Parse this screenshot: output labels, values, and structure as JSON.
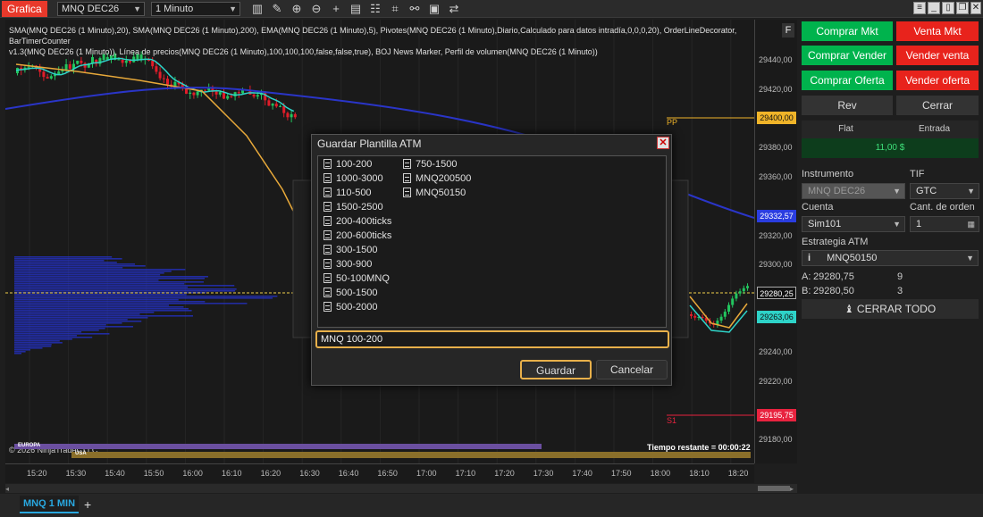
{
  "app": {
    "title": "Grafica",
    "instrument": "MNQ DEC26",
    "interval": "1 Minuto"
  },
  "toolbar_icons": [
    "bars-icon",
    "pencil-icon",
    "zoom-in-icon",
    "zoom-out-icon",
    "crosshair-icon",
    "data-box-icon",
    "properties-icon",
    "indicators-icon",
    "strategies-icon",
    "templates-icon",
    "attach-icon"
  ],
  "chart": {
    "indicators_line1": "SMA(MNQ DEC26 (1 Minuto),20), SMA(MNQ DEC26 (1 Minuto),200), EMA(MNQ DEC26 (1 Minuto),5), Pivotes(MNQ DEC26 (1 Minuto),Diario,Calculado para datos intradía,0,0,0,20), OrderLineDecorator, BarTimerCounter",
    "indicators_line2": "v1.3(MNQ DEC26 (1 Minuto)), Línea de precios(MNQ DEC26 (1 Minuto),100,100,100,false,false,true), BOJ News Marker, Perfil de volumen(MNQ DEC26 (1 Minuto))",
    "copyright": "© 2026 NinjaTrader, LLC",
    "time_remaining": "Tiempo restante = 00:00:22",
    "f_button": "F",
    "pp_label": "PP",
    "s1_label": "S1",
    "session_labels": [
      "EUROPA",
      "USA"
    ],
    "price_ticks": [
      "29440,00",
      "29420,00",
      "29400,00",
      "29380,00",
      "29360,00",
      "29340,00",
      "29320,00",
      "29300,00",
      "29280,00",
      "29260,00",
      "29240,00",
      "29220,00",
      "29200,00",
      "29180,00"
    ],
    "price_markers": [
      {
        "value": "29400,00",
        "color": "#f0b429"
      },
      {
        "value": "29332,57",
        "color": "#2a3de0"
      },
      {
        "value": "29280,25",
        "color": "#111111"
      },
      {
        "value": "29263,06",
        "color": "#2ed3c8"
      },
      {
        "value": "29195,75",
        "color": "#e8233f"
      }
    ],
    "time_ticks": [
      "15:20",
      "15:30",
      "15:40",
      "15:50",
      "16:00",
      "16:10",
      "16:20",
      "16:30",
      "16:40",
      "16:50",
      "17:00",
      "17:10",
      "17:20",
      "17:30",
      "17:40",
      "17:50",
      "18:00",
      "18:10",
      "18:20"
    ]
  },
  "dialog": {
    "title": "Guardar Plantilla ATM",
    "templates_col1": [
      "100-200",
      "1000-3000",
      "110-500",
      "1500-2500",
      "200-400ticks",
      "200-600ticks",
      "300-1500",
      "300-900",
      "50-100MNQ",
      "500-1500",
      "500-2000"
    ],
    "templates_col2": [
      "750-1500",
      "MNQ200500",
      "MNQ50150"
    ],
    "name_value": "MNQ 100-200",
    "save_label": "Guardar",
    "cancel_label": "Cancelar"
  },
  "panel": {
    "buy_mkt": "Comprar Mkt",
    "sell_mkt": "Venta Mkt",
    "buy_bid": "Comprar Vender",
    "sell_ask": "Vender venta",
    "buy_ask": "Comprar Oferta",
    "sell_bid": "Vender oferta",
    "rev": "Rev",
    "close": "Cerrar",
    "position_label": "Flat",
    "entry_label": "Entrada",
    "pnl": "11,00 $",
    "instrument_label": "Instrumento",
    "instrument_value": "MNQ DEC26",
    "tif_label": "TIF",
    "tif_value": "GTC",
    "account_label": "Cuenta",
    "account_value": "Sim101",
    "qty_label": "Cant. de orden",
    "qty_value": "1",
    "atm_label": "Estrategia ATM",
    "atm_value": "MNQ50150",
    "ask_label": "A:",
    "ask_price": "29280,75",
    "ask_size": "9",
    "bid_label": "B:",
    "bid_price": "29280,50",
    "bid_size": "3",
    "close_all": "CERRAR TODO"
  },
  "tabs": {
    "active": "MNQ 1 MIN",
    "add": "+"
  },
  "colors": {
    "accent": "#e8392b",
    "buy": "#00b34d",
    "sell": "#e8231c",
    "focus": "#e8b04a"
  }
}
